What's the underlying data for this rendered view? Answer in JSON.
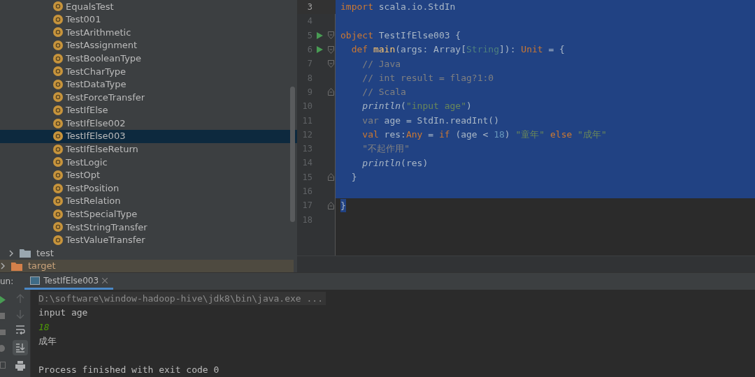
{
  "project_tree": [
    {
      "children": [
        {
          "children": [
            {
              "label": "EqualsTest",
              "selected": false
            },
            {
              "label": "Test001",
              "selected": false
            },
            {
              "label": "TestArithmetic",
              "selected": false
            },
            {
              "label": "TestAssignment",
              "selected": false
            },
            {
              "label": "TestBooleanType",
              "selected": false
            },
            {
              "label": "TestCharType",
              "selected": false
            },
            {
              "label": "TestDataType",
              "selected": false
            },
            {
              "label": "TestForceTransfer",
              "selected": false
            },
            {
              "label": "TestIfElse",
              "selected": false
            },
            {
              "label": "TestIfElse002",
              "selected": false
            },
            {
              "label": "TestIfElse003",
              "selected": true
            },
            {
              "label": "TestIfElseReturn",
              "selected": false
            },
            {
              "label": "TestLogic",
              "selected": false
            },
            {
              "label": "TestOpt",
              "selected": false
            },
            {
              "label": "TestPosition",
              "selected": false
            },
            {
              "label": "TestRelation",
              "selected": false
            },
            {
              "label": "TestSpecialType",
              "selected": false
            },
            {
              "label": "TestStringTransfer",
              "selected": false
            },
            {
              "label": "TestValueTransfer",
              "selected": false
            }
          ]
        },
        {
          "label": "test",
          "kind": "folder",
          "expanded": false
        }
      ]
    },
    {
      "label": "target",
      "kind": "folder",
      "expanded": false,
      "excluded": true
    }
  ],
  "editor": {
    "lines": [
      {
        "number": "3",
        "current": true,
        "selected": true,
        "tokens": [
          {
            "kind": "keyword",
            "text": "import"
          },
          {
            "kind": "plain",
            "text": " scala.io.StdIn"
          }
        ]
      },
      {
        "number": "4",
        "current": false,
        "selected": true
      },
      {
        "number": "5",
        "current": false,
        "selected": true,
        "run": true,
        "fold_open": true,
        "tokens": [
          {
            "kind": "keyword",
            "text": "object"
          },
          {
            "kind": "plain",
            "text": " TestIfElse003 {"
          }
        ]
      },
      {
        "number": "6",
        "current": false,
        "selected": true,
        "run": true,
        "fold_open": true,
        "tokens": [
          {
            "kind": "keyword",
            "text": "  def"
          },
          {
            "kind": "function",
            "text": " main"
          },
          {
            "kind": "plain",
            "text": "(args: Array["
          },
          {
            "kind": "type",
            "text": "String"
          },
          {
            "kind": "plain",
            "text": "]): "
          },
          {
            "kind": "keyword",
            "text": "Unit"
          },
          {
            "kind": "plain",
            "text": " = {"
          }
        ]
      },
      {
        "number": "7",
        "current": false,
        "selected": true,
        "fold_open": true,
        "tokens": [
          {
            "kind": "comment",
            "text": "    // Java"
          }
        ]
      },
      {
        "number": "8",
        "current": false,
        "selected": true,
        "tokens": [
          {
            "kind": "comment",
            "text": "    // int result = flag?1:0"
          }
        ]
      },
      {
        "number": "9",
        "current": false,
        "selected": true,
        "fold_close": true,
        "tokens": [
          {
            "kind": "comment",
            "text": "    // Scala"
          }
        ]
      },
      {
        "number": "10",
        "current": false,
        "selected": true,
        "tokens": [
          {
            "kind": "call",
            "text": "    println"
          },
          {
            "kind": "plain",
            "text": "("
          },
          {
            "kind": "string",
            "text": "\"input age\""
          },
          {
            "kind": "plain",
            "text": ")"
          }
        ]
      },
      {
        "number": "11",
        "current": false,
        "selected": true,
        "tokens": [
          {
            "kind": "unused",
            "text": "    var"
          },
          {
            "kind": "plain",
            "text": " age = StdIn.readInt()"
          }
        ]
      },
      {
        "number": "12",
        "current": false,
        "selected": true,
        "tokens": [
          {
            "kind": "keyword",
            "text": "    val"
          },
          {
            "kind": "plain",
            "text": " res:"
          },
          {
            "kind": "keyword",
            "text": "Any"
          },
          {
            "kind": "plain",
            "text": " = "
          },
          {
            "kind": "keyword",
            "text": "if"
          },
          {
            "kind": "plain",
            "text": " (age < "
          },
          {
            "kind": "number",
            "text": "18"
          },
          {
            "kind": "plain",
            "text": ") "
          },
          {
            "kind": "string",
            "text": "\"童年\""
          },
          {
            "kind": "keyword",
            "text": " else"
          },
          {
            "kind": "string",
            "text": " \"成年\""
          }
        ]
      },
      {
        "number": "13",
        "current": false,
        "selected": true,
        "tokens": [
          {
            "kind": "unused",
            "text": "    \"不起作用\""
          }
        ]
      },
      {
        "number": "14",
        "current": false,
        "selected": true,
        "tokens": [
          {
            "kind": "call",
            "text": "    println"
          },
          {
            "kind": "plain",
            "text": "(res)"
          }
        ]
      },
      {
        "number": "15",
        "current": false,
        "selected": true,
        "fold_close": true,
        "tokens": [
          {
            "kind": "plain",
            "text": "  }"
          }
        ]
      },
      {
        "number": "16",
        "current": false,
        "selected": true
      },
      {
        "number": "17",
        "current": false,
        "selected": true,
        "selection_end": true,
        "fold_close": true,
        "tokens": [
          {
            "kind": "plain",
            "text": "}"
          }
        ]
      },
      {
        "number": "18",
        "current": false,
        "selected": false
      }
    ]
  },
  "run_panel": {
    "label": "un:",
    "tabs": [
      {
        "label": "TestIfElse003",
        "selected": true
      }
    ],
    "output": [
      {
        "kind": "command",
        "text": "D:\\software\\window-hadoop-hive\\jdk8\\bin\\java.exe ..."
      },
      {
        "kind": "stdout",
        "text": "input age"
      },
      {
        "kind": "stdin",
        "text": "18"
      },
      {
        "kind": "stdout",
        "text": "成年"
      },
      {
        "kind": "blank"
      },
      {
        "kind": "stdout",
        "text": "Process finished with exit code 0"
      }
    ]
  }
}
